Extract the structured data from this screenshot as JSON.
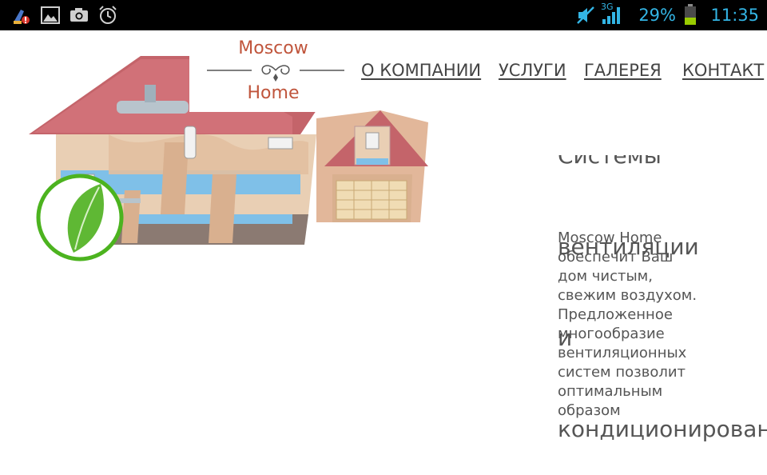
{
  "status_bar": {
    "network": "3G",
    "battery_percent": "29%",
    "time": "11:35",
    "text_color": "#33b5e5",
    "icons": [
      "cleaner-app-icon",
      "gallery-icon",
      "camera-icon",
      "alarm-icon",
      "mute-icon",
      "signal-icon",
      "battery-icon"
    ]
  },
  "logo": {
    "line1": "Moscow",
    "line2": "Home",
    "color": "#c0553c"
  },
  "nav": {
    "items": [
      "О КОМПАНИИ",
      "УСЛУГИ",
      "ГАЛЕРЕЯ",
      "КОНТАКТ"
    ]
  },
  "content": {
    "title_lines": [
      "Системы",
      "вентиляции",
      "и",
      "кондиционирования"
    ],
    "body": "Moscow Home обеспечит Ваш дом чистым, свежим воздухом. Предложенное многообразие вентиляционных систем позволит оптимальным образом"
  },
  "hero": {
    "leaf_icon": "leaf-icon",
    "accent_color": "#4cb31f"
  }
}
